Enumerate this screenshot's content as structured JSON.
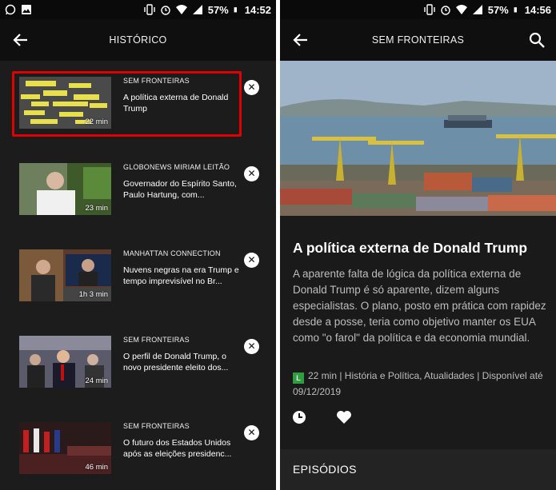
{
  "left_screen": {
    "status": {
      "battery": "57%",
      "time": "14:52"
    },
    "title": "HISTÓRICO",
    "items": [
      {
        "program": "SEM FRONTEIRAS",
        "title": "A política externa de Donald Trump",
        "duration": "22 min",
        "progress": 1.0
      },
      {
        "program": "GLOBONEWS MIRIAM LEITÃO",
        "title": "Governador do Espírito Santo, Paulo Hartung, com...",
        "duration": "23 min",
        "progress": 1.0
      },
      {
        "program": "MANHATTAN CONNECTION",
        "title": "Nuvens negras na era Trump e tempo imprevisível no Br...",
        "duration": "1h 3 min",
        "progress": 0.18
      },
      {
        "program": "SEM FRONTEIRAS",
        "title": "O perfil de Donald Trump, o novo presidente eleito dos...",
        "duration": "24 min",
        "progress": 1.0
      },
      {
        "program": "SEM FRONTEIRAS",
        "title": "O futuro dos Estados Unidos após as eleições presidenc...",
        "duration": "46 min",
        "progress": 1.0
      }
    ],
    "thumb1_words": [
      "they are worst",
      "really bad",
      "FAKE NEWS",
      "Terrible",
      "Fake News",
      "playing with fire",
      "very bad",
      "Devils",
      "Dead Wrong",
      "fairy tale"
    ]
  },
  "right_screen": {
    "status": {
      "battery": "57%",
      "time": "14:56"
    },
    "title": "SEM FRONTEIRAS",
    "episode_title": "A política externa de Donald Trump",
    "description": "A aparente falta de lógica da política externa de Donald Trump é só aparente, dizem alguns especialistas. O plano, posto em prática com rapidez desde a posse, teria como objetivo manter os EUA como \"o farol\" da política e da economia mundial.",
    "rating": "L",
    "info": "22 min | História e Política, Atualidades | Disponível até 09/12/2019",
    "episodes_label": "EPISÓDIOS"
  }
}
